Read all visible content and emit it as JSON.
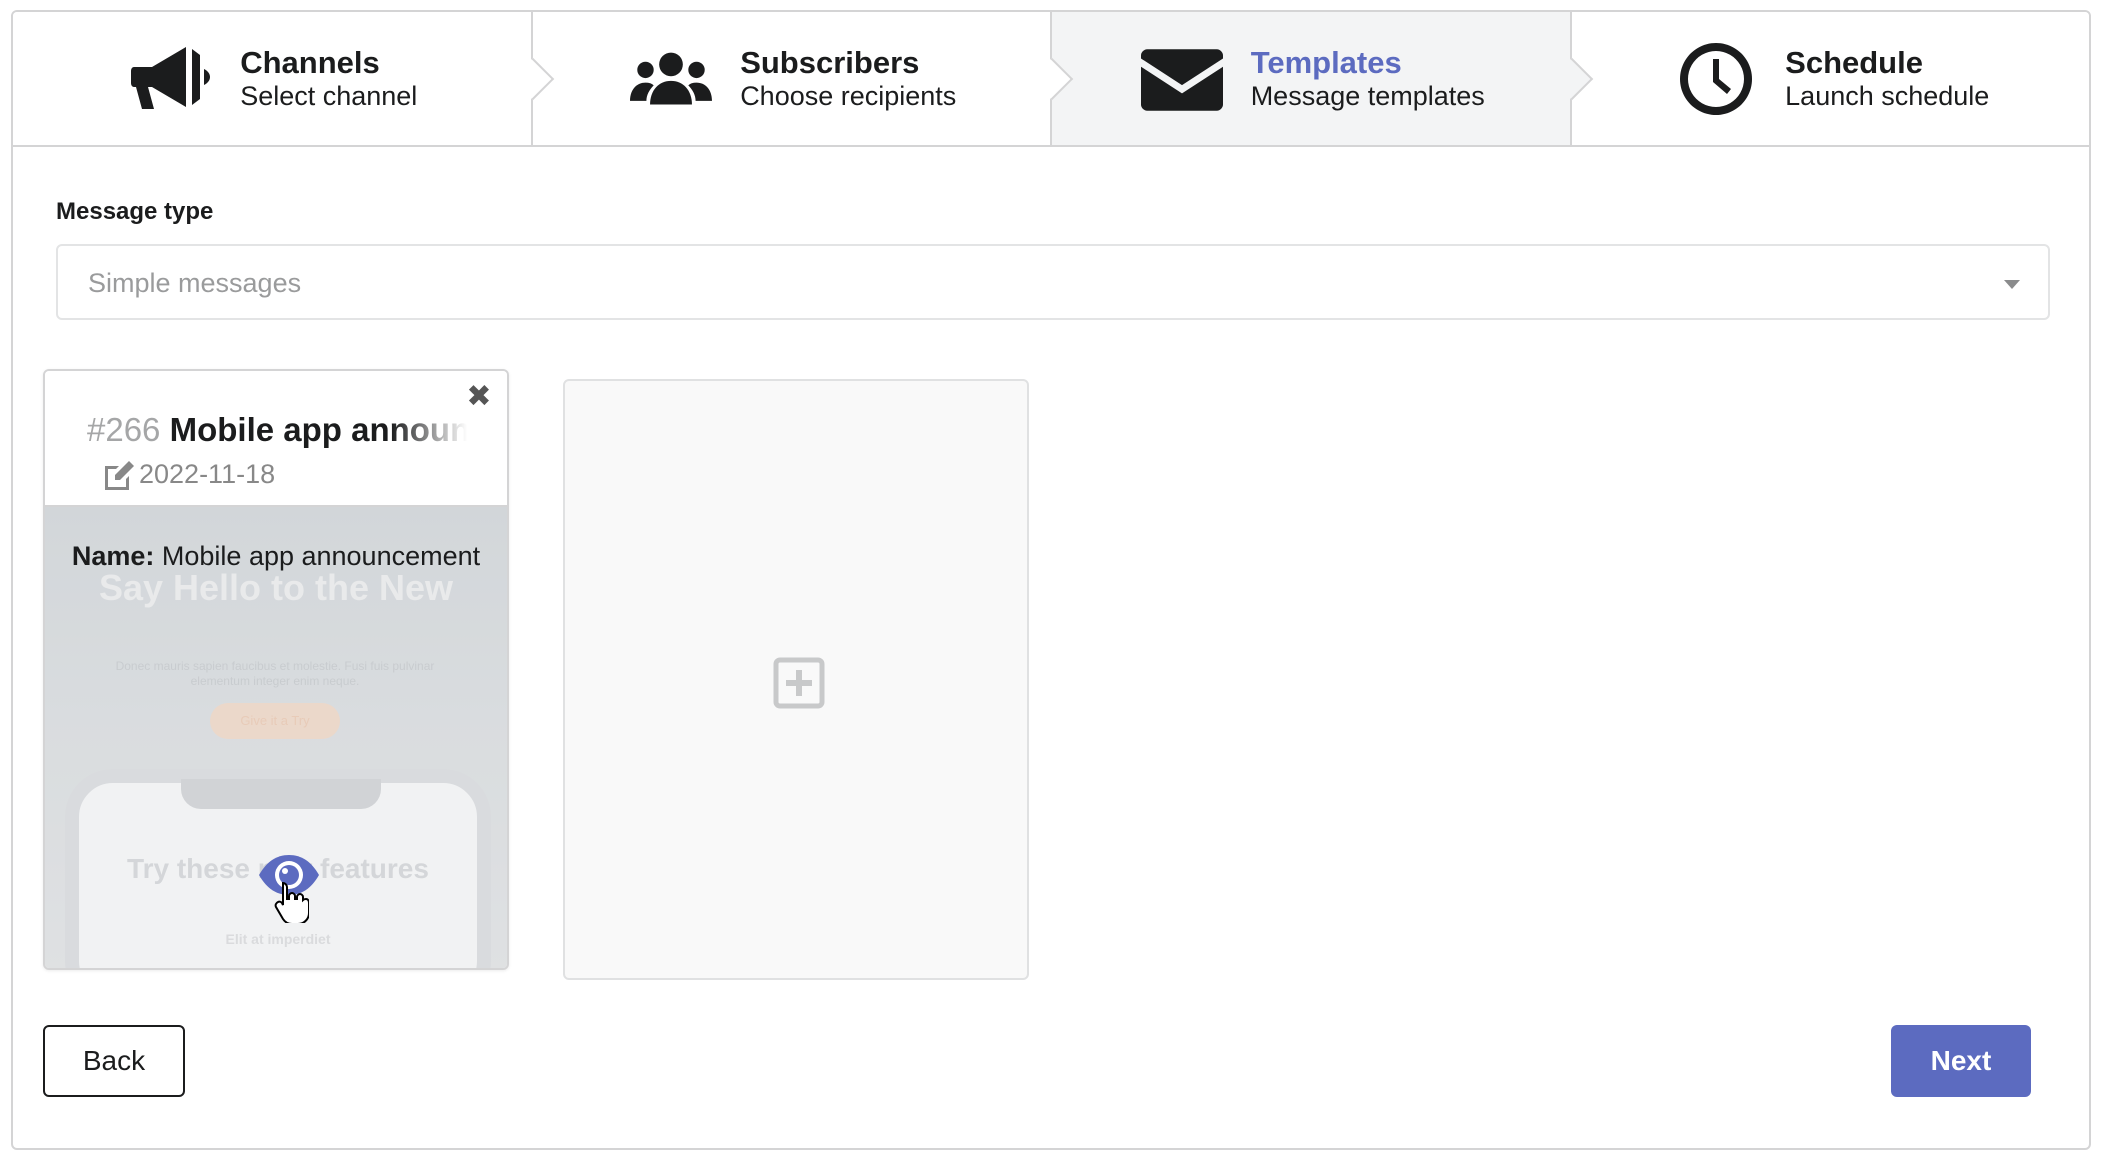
{
  "steps": [
    {
      "title": "Channels",
      "desc": "Select channel",
      "icon": "megaphone-icon",
      "active": false
    },
    {
      "title": "Subscribers",
      "desc": "Choose recipients",
      "icon": "users-icon",
      "active": false
    },
    {
      "title": "Templates",
      "desc": "Message templates",
      "icon": "envelope-icon",
      "active": true
    },
    {
      "title": "Schedule",
      "desc": "Launch schedule",
      "icon": "clock-icon",
      "active": false
    }
  ],
  "form": {
    "message_type_label": "Message type",
    "message_type_value": "Simple messages"
  },
  "template_card": {
    "number": "#266",
    "title": "Mobile app announcement",
    "date": "2022-11-18",
    "name_label": "Name:",
    "name_value": "Mobile app announcement",
    "preview": {
      "headline": "Say Hello to the New",
      "lorem": "Donec mauris sapien faucibus et molestie. Fusi fuis pulvinar elementum integer enim neque.",
      "cta": "Give it a Try",
      "phone_title": "Try these new features",
      "phone_sub": "Elit at imperdiet"
    }
  },
  "buttons": {
    "back": "Back",
    "next": "Next"
  },
  "colors": {
    "accent": "#5c6bc0",
    "border": "#d4d4d5",
    "active_step_bg": "#f3f4f5"
  }
}
